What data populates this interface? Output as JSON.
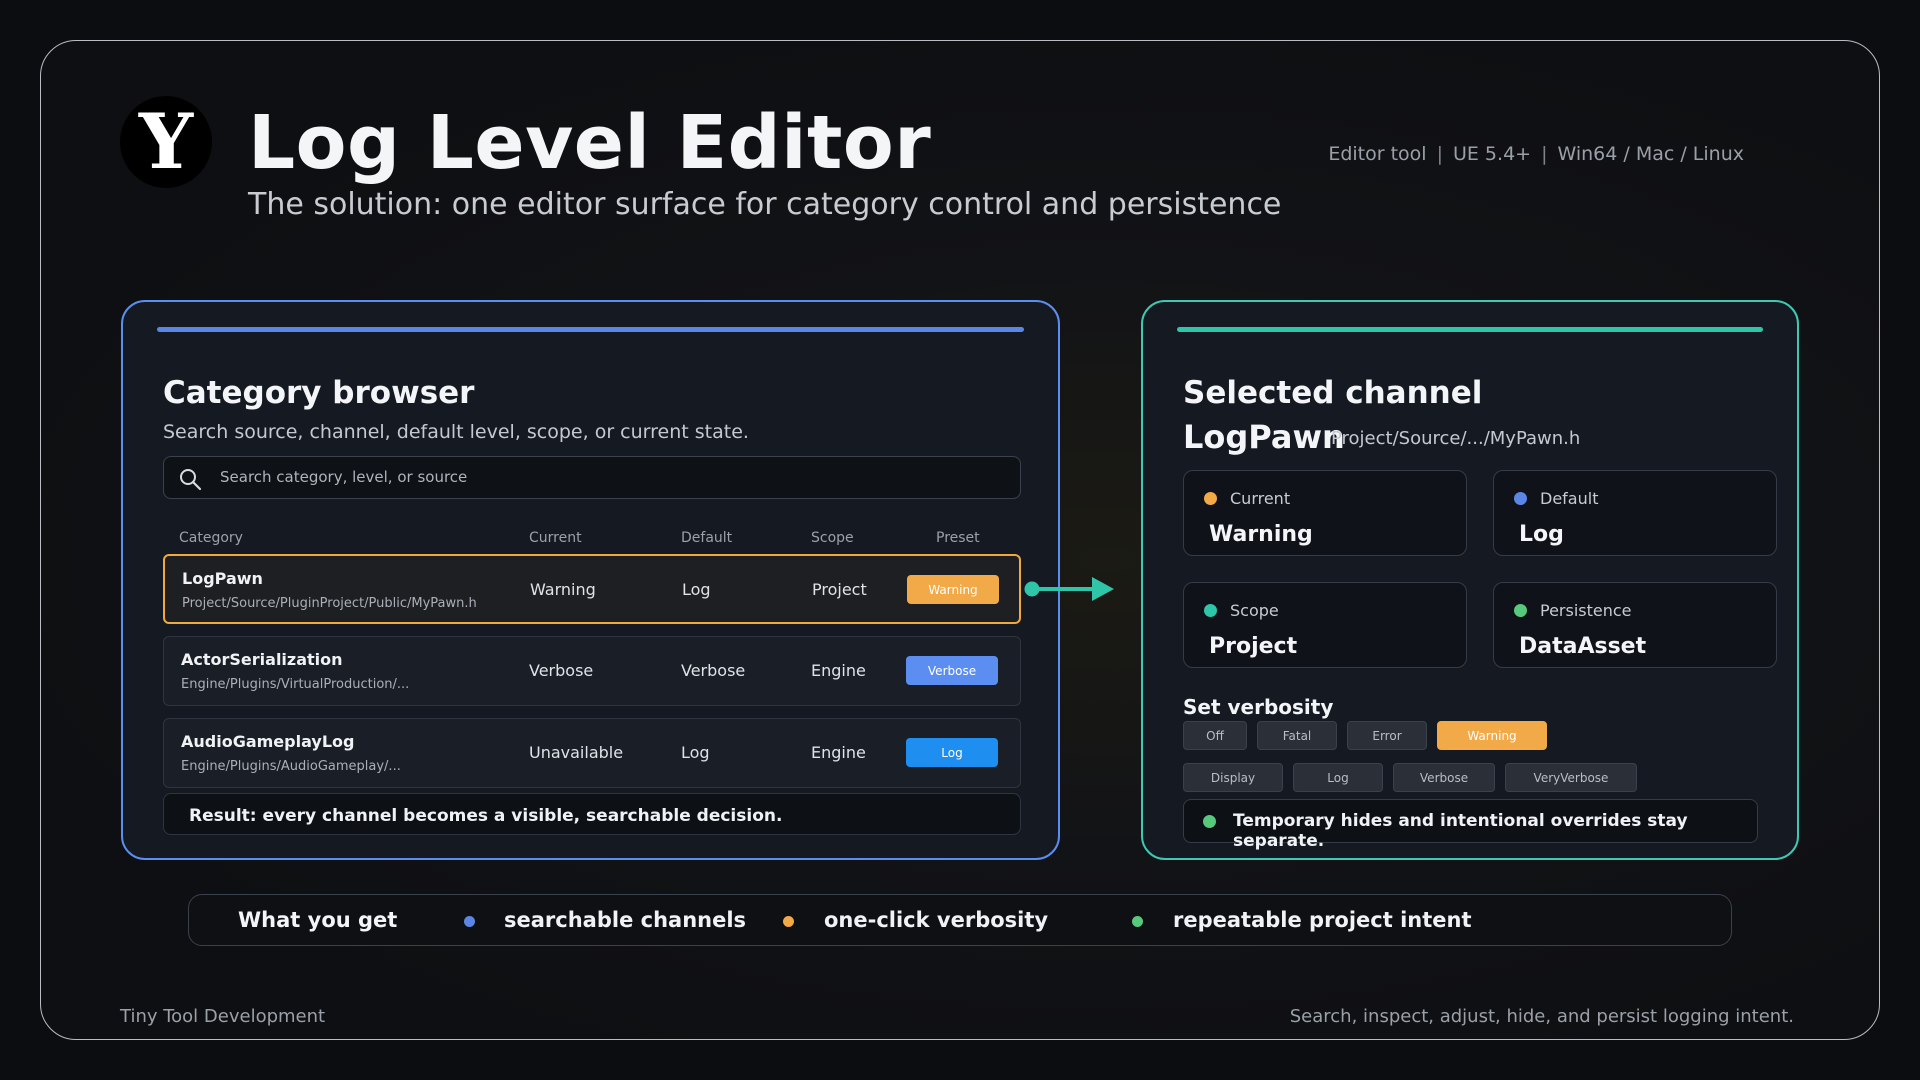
{
  "header": {
    "logo_letter": "Y",
    "title": "Log Level Editor",
    "subtitle": "The solution: one editor surface for category control and persistence",
    "meta": [
      "Editor tool",
      "UE 5.4+",
      "Win64 / Mac / Linux"
    ]
  },
  "browser": {
    "title": "Category browser",
    "description": "Search source, channel, default level, scope, or current state.",
    "search_placeholder": "Search category, level, or source",
    "columns": [
      "Category",
      "Current",
      "Default",
      "Scope",
      "Preset"
    ],
    "rows": [
      {
        "name": "LogPawn",
        "path": "Project/Source/PluginProject/Public/MyPawn.h",
        "current": "Warning",
        "default": "Log",
        "scope": "Project",
        "preset": "Warning",
        "preset_color": "#f2a947",
        "selected": true
      },
      {
        "name": "ActorSerialization",
        "path": "Engine/Plugins/VirtualProduction/...",
        "current": "Verbose",
        "default": "Verbose",
        "scope": "Engine",
        "preset": "Verbose",
        "preset_color": "#5b8ef0",
        "selected": false
      },
      {
        "name": "AudioGameplayLog",
        "path": "Engine/Plugins/AudioGameplay/...",
        "current": "Unavailable",
        "default": "Log",
        "scope": "Engine",
        "preset": "Log",
        "preset_color": "#1f8ef1",
        "selected": false
      }
    ],
    "result": "Result: every channel becomes a visible, searchable decision."
  },
  "selected": {
    "title": "Selected channel",
    "name": "LogPawn",
    "path": "Project/Source/.../MyPawn.h",
    "cards": [
      {
        "label": "Current",
        "value": "Warning",
        "color": "#f2a947",
        "icon": "dot"
      },
      {
        "label": "Default",
        "value": "Log",
        "color": "#5b86e6",
        "icon": "dot"
      },
      {
        "label": "Scope",
        "value": "Project",
        "color": "#2fc5a8",
        "icon": "dot"
      },
      {
        "label": "Persistence",
        "value": "DataAsset",
        "color": "#57c97c",
        "icon": "dot"
      }
    ],
    "verbosity_title": "Set verbosity",
    "verbosity_levels": [
      "Off",
      "Fatal",
      "Error",
      "Warning",
      "Display",
      "Log",
      "Verbose",
      "VeryVerbose"
    ],
    "active_level": "Warning",
    "note": "Temporary hides and intentional overrides stay separate."
  },
  "benefits": {
    "title": "What you get",
    "items": [
      {
        "label": "searchable channels",
        "color": "#5b86e6"
      },
      {
        "label": "one-click verbosity",
        "color": "#f2a947"
      },
      {
        "label": "repeatable project intent",
        "color": "#57c97c"
      }
    ]
  },
  "footer": {
    "left": "Tiny Tool Development",
    "right": "Search, inspect, adjust, hide, and persist logging intent."
  },
  "colors": {
    "accent_blue": "#5b8ef0",
    "accent_teal": "#3fc9b2",
    "accent_orange": "#f0a93e",
    "accent_green": "#57c97c"
  }
}
